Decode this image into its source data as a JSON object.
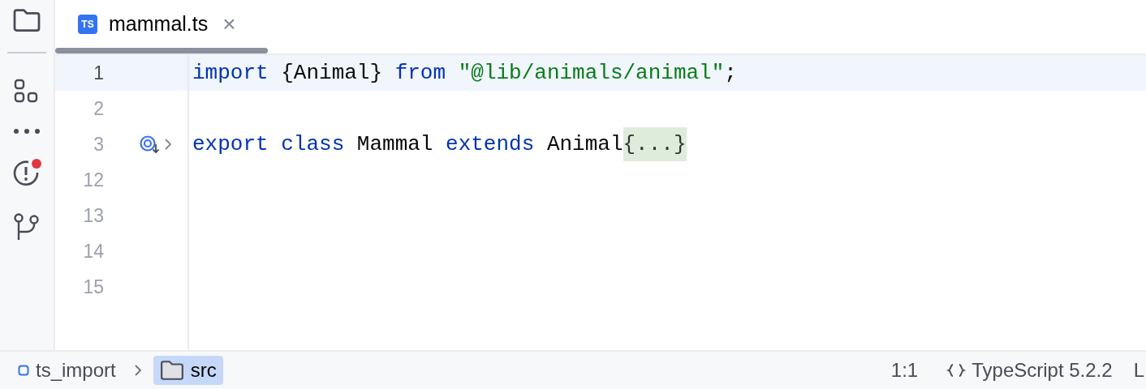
{
  "sidebar": {
    "problems_badge": true
  },
  "tabs": [
    {
      "icon_text": "TS",
      "label": "mammal.ts",
      "selected": true,
      "close": "×"
    }
  ],
  "editor": {
    "lines": [
      {
        "number": "1",
        "current": true,
        "tokens": [
          {
            "kind": "keyword",
            "text": "import"
          },
          {
            "kind": "plain",
            "text": " {Animal} "
          },
          {
            "kind": "keyword",
            "text": "from "
          },
          {
            "kind": "string",
            "text": "\"@lib/animals/animal\""
          },
          {
            "kind": "plain",
            "text": ";"
          }
        ]
      },
      {
        "number": "2",
        "current": false
      },
      {
        "number": "3",
        "current": false,
        "gutter_icons": true,
        "tokens": [
          {
            "kind": "keyword",
            "text": "export "
          },
          {
            "kind": "keyword",
            "text": "class"
          },
          {
            "kind": "plain",
            "text": " Mammal "
          },
          {
            "kind": "keyword",
            "text": "extends"
          },
          {
            "kind": "plain",
            "text": " Animal"
          },
          {
            "kind": "folded",
            "text": "{...}"
          }
        ]
      },
      {
        "number": "12",
        "current": false
      },
      {
        "number": "13",
        "current": false
      },
      {
        "number": "14",
        "current": false
      },
      {
        "number": "15",
        "current": false
      }
    ]
  },
  "status_bar": {
    "breadcrumbs": [
      {
        "kind": "module",
        "label": "ts_import",
        "selected": false
      },
      {
        "kind": "folder",
        "label": "src",
        "selected": true
      }
    ],
    "position": "1:1",
    "language": "TypeScript 5.2.2",
    "cut_item": "L"
  }
}
